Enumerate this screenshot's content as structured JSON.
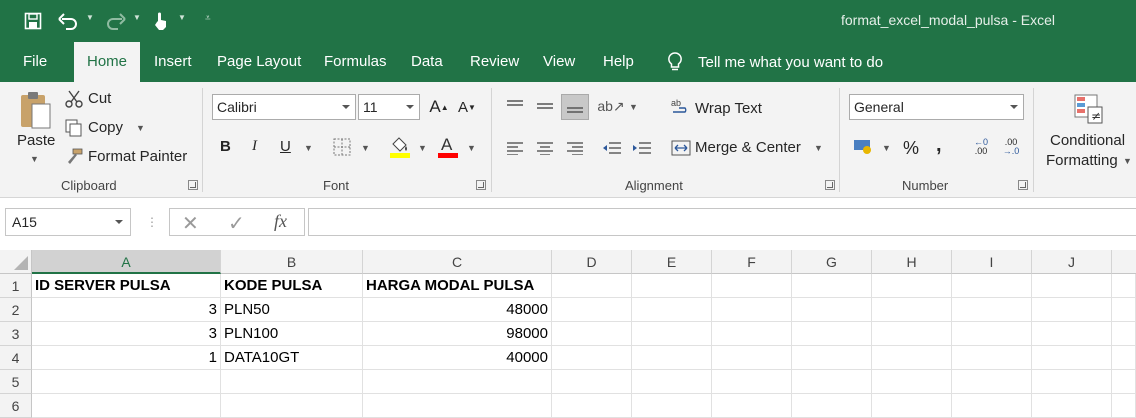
{
  "titlebar": {
    "title": "format_excel_modal_pulsa  -  Excel"
  },
  "tabs": [
    "File",
    "Home",
    "Insert",
    "Page Layout",
    "Formulas",
    "Data",
    "Review",
    "View",
    "Help"
  ],
  "tell_me": "Tell me what you want to do",
  "clipboard": {
    "paste": "Paste",
    "cut": "Cut",
    "copy": "Copy",
    "format_painter": "Format Painter",
    "label": "Clipboard"
  },
  "font": {
    "name": "Calibri",
    "size": "11",
    "bold": "B",
    "italic": "I",
    "underline": "U",
    "label": "Font"
  },
  "alignment": {
    "wrap_text": "Wrap Text",
    "merge_center": "Merge & Center",
    "label": "Alignment"
  },
  "number": {
    "format": "General",
    "percent": "%",
    "comma": ",",
    "inc_decimal": "←0 .00",
    "dec_decimal": ".00 →.0",
    "label": "Number"
  },
  "styles": {
    "conditional": "Conditional",
    "formatting": "Formatting"
  },
  "formula_bar": {
    "name_box": "A15",
    "fx": "fx",
    "content": ""
  },
  "columns": [
    "A",
    "B",
    "C",
    "D",
    "E",
    "F",
    "G",
    "H",
    "I",
    "J"
  ],
  "selected_column": "A",
  "rows": [
    {
      "num": "1",
      "cells": [
        "ID SERVER PULSA",
        "KODE PULSA",
        "HARGA MODAL PULSA"
      ]
    },
    {
      "num": "2",
      "cells": [
        "3",
        "PLN50",
        "48000"
      ]
    },
    {
      "num": "3",
      "cells": [
        "3",
        "PLN100",
        "98000"
      ]
    },
    {
      "num": "4",
      "cells": [
        "1",
        "DATA10GT",
        "40000"
      ]
    },
    {
      "num": "5",
      "cells": [
        "",
        "",
        ""
      ]
    },
    {
      "num": "6",
      "cells": [
        "",
        "",
        ""
      ]
    }
  ],
  "colors": {
    "excel_green": "#217346",
    "highlight_yellow": "#ffff00",
    "font_red": "#ff0000"
  }
}
